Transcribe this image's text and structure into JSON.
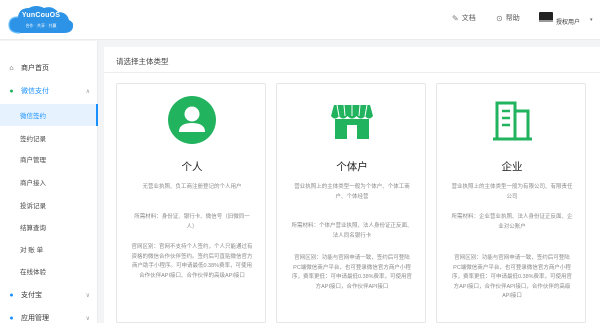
{
  "header": {
    "logo_text": "YunCouOS",
    "logo_tagline": "合作 · 共享 · 共赢",
    "docs_label": "文档",
    "help_label": "帮助",
    "username": "授权用户",
    "user_caret": "▾"
  },
  "sidebar": {
    "items": [
      {
        "label": "商户首页",
        "icon": "home-icon",
        "glyph": "⌂"
      },
      {
        "label": "微信支付",
        "icon": "wechat-pay-icon",
        "glyph": "●",
        "expanded": true,
        "chevron": "∧"
      },
      {
        "label": "支付宝",
        "icon": "alipay-icon",
        "glyph": "●",
        "chevron": "∨"
      },
      {
        "label": "应用管理",
        "icon": "app-icon",
        "glyph": "●",
        "chevron": "∨"
      }
    ],
    "sub_items": [
      {
        "label": "微信签约",
        "active": true
      },
      {
        "label": "签约记录"
      },
      {
        "label": "商户管理"
      },
      {
        "label": "商户接入"
      },
      {
        "label": "投诉记录"
      },
      {
        "label": "结算查询"
      },
      {
        "label": "对 账 单"
      },
      {
        "label": "在线体验"
      }
    ]
  },
  "main": {
    "title": "请选择主体类型",
    "cards": [
      {
        "name": "个人",
        "icon": "person-icon",
        "icon_color": "#22b35e",
        "desc": "无营业执照、负工商注册登记的个人用户",
        "materials": "所需材料：身份证、银行卡、微信号（旧微同一人）",
        "notes": "官网区别：官网不支持个人签约，个人只能通过有资格的微信合作伙伴签约。签约后可直贴微信官方商户助手小程序。可申请最低0.38%费率，可使用合作伙伴API接口、合作伙伴的高级API接口"
      },
      {
        "name": "个体户",
        "icon": "storefront-icon",
        "icon_color": "#22b35e",
        "desc": "营业执照上的主体类型一般为个体户、个体工商户、个体经营",
        "materials": "所需材料：个体户营业执照、法人身份证正反面、法人同名银行卡",
        "notes": "官网区别：功能与官网申请一致，签约后可登陆PC端微信商户平台，也可登录微信官方商户小程序，费率更低：可申请最低0.38%费率，可使用官方API接口，合作伙伴API接口"
      },
      {
        "name": "企业",
        "icon": "building-icon",
        "icon_color": "#22b35e",
        "desc": "营业执照上的主体类型一般为有限公司、有限责任公司",
        "materials": "所需材料：企业营业执照、法人身份证正反面、企业对公账户",
        "notes": "官网区别：功能与官网申请一致，签约后可登陆PC端微信商户平台，也可登录微信官方商户小程序，费率更低：可申请最低0.38%费率，可使用官方API接口，合作伙伴API接口，合作伙伴的高级API接口"
      }
    ]
  }
}
